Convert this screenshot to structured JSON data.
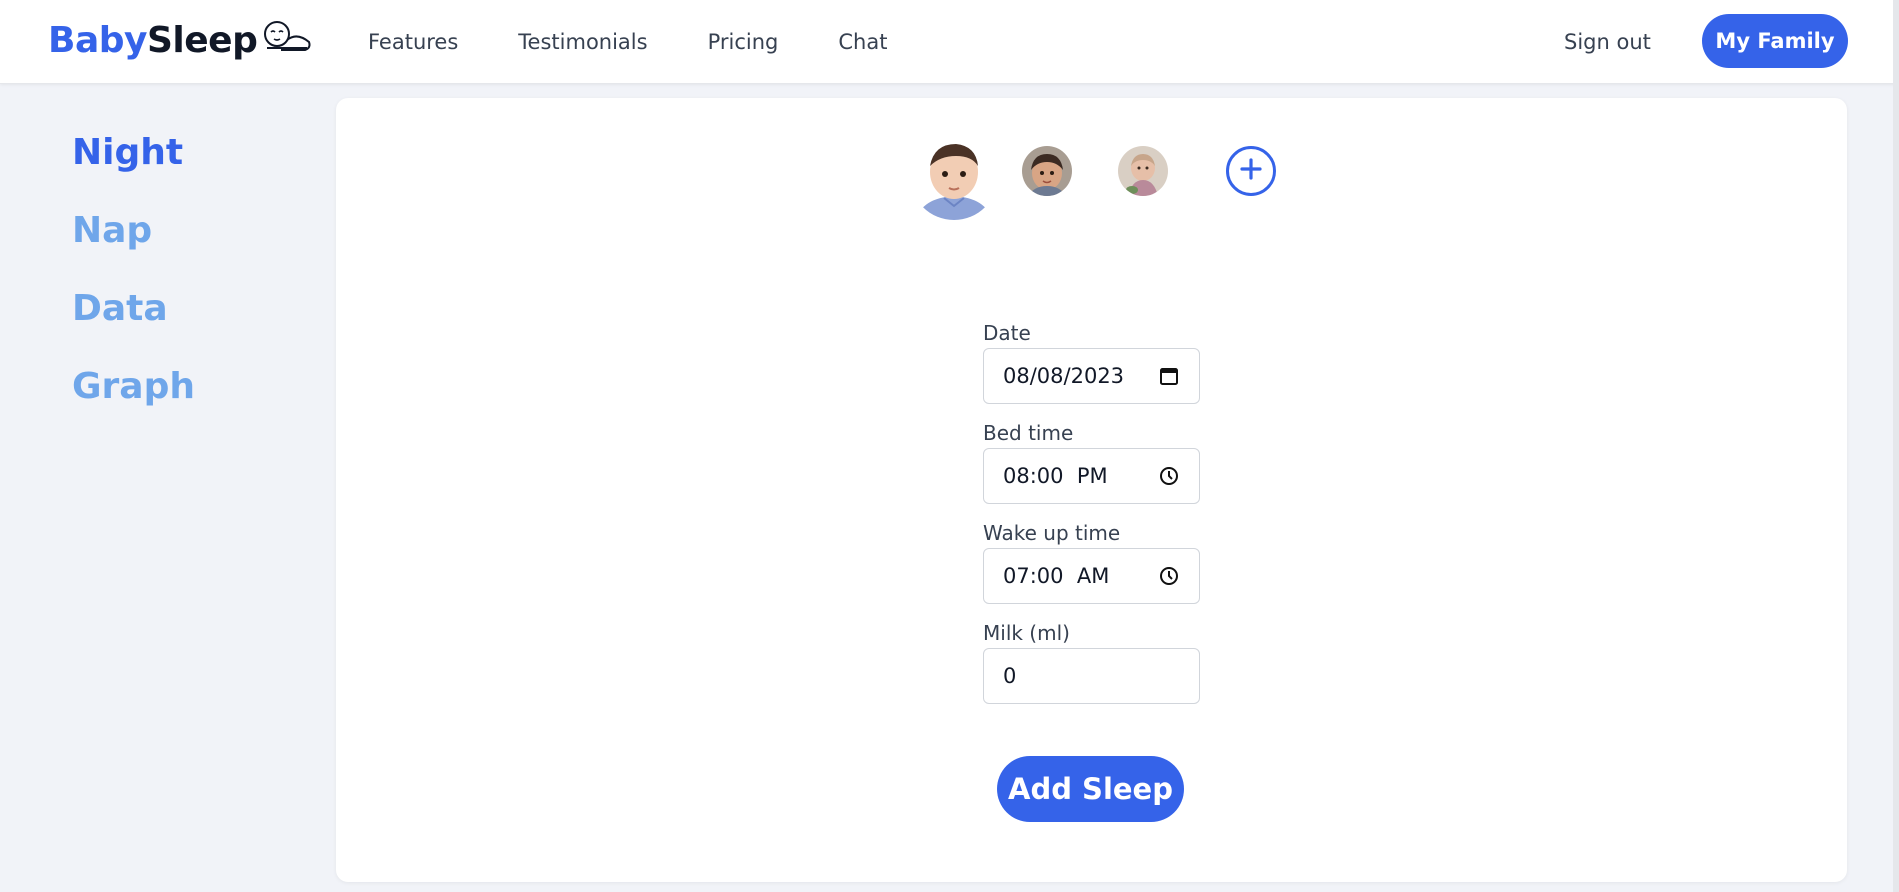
{
  "brand": {
    "part1": "Baby",
    "part2": "Sleep",
    "logo_icon": "sleeping-baby-icon",
    "color": "#3563e9"
  },
  "nav": {
    "features": "Features",
    "testimonials": "Testimonials",
    "pricing": "Pricing",
    "chat": "Chat"
  },
  "header": {
    "sign_out": "Sign out",
    "family_button": "My Family"
  },
  "sidebar": {
    "items": [
      {
        "label": "Night",
        "active": true
      },
      {
        "label": "Nap",
        "active": false
      },
      {
        "label": "Data",
        "active": false
      },
      {
        "label": "Graph",
        "active": false
      }
    ]
  },
  "children": {
    "add_icon": "plus-circle-icon"
  },
  "form": {
    "date_label": "Date",
    "date_value": "08/08/2023",
    "bed_label": "Bed time",
    "bed_value": "08:00  PM",
    "wake_label": "Wake up time",
    "wake_value": "07:00  AM",
    "milk_label": "Milk (ml)",
    "milk_value": "0",
    "submit": "Add Sleep"
  },
  "colors": {
    "accent": "#3563e9",
    "sidebar_inactive": "#6fa6ea",
    "background": "#f1f3f8"
  }
}
